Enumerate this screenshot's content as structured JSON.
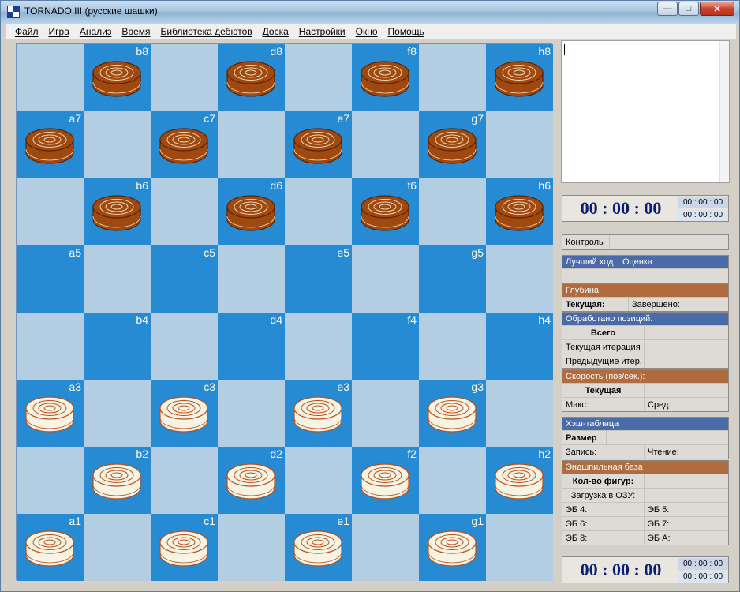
{
  "window": {
    "title": "TORNADO III (русские шашки)",
    "buttons": {
      "minimize": "—",
      "maximize": "□",
      "close": "✕"
    }
  },
  "menu": [
    "Файл",
    "Игра",
    "Анализ",
    "Время",
    "Библиотека дебютов",
    "Доска",
    "Настройки",
    "Окно",
    "Помощь"
  ],
  "colors": {
    "light_square": "#b3cde3",
    "dark_square": "#268bd2",
    "black_piece": "#a0490f",
    "white_piece": "#f8f4e4",
    "header_brown": "#b06c3e",
    "header_blue": "#4a6aa8",
    "clock_text": "#0b1e74"
  },
  "board": {
    "rows": [
      {
        "rank": "8",
        "squares": [
          {
            "label": "",
            "piece": ""
          },
          {
            "label": "b8",
            "piece": "black"
          },
          {
            "label": "",
            "piece": ""
          },
          {
            "label": "d8",
            "piece": "black"
          },
          {
            "label": "",
            "piece": ""
          },
          {
            "label": "f8",
            "piece": "black"
          },
          {
            "label": "",
            "piece": ""
          },
          {
            "label": "h8",
            "piece": "black"
          }
        ]
      },
      {
        "rank": "7",
        "squares": [
          {
            "label": "a7",
            "piece": "black"
          },
          {
            "label": "",
            "piece": ""
          },
          {
            "label": "c7",
            "piece": "black"
          },
          {
            "label": "",
            "piece": ""
          },
          {
            "label": "e7",
            "piece": "black"
          },
          {
            "label": "",
            "piece": ""
          },
          {
            "label": "g7",
            "piece": "black"
          },
          {
            "label": "",
            "piece": ""
          }
        ]
      },
      {
        "rank": "6",
        "squares": [
          {
            "label": "",
            "piece": ""
          },
          {
            "label": "b6",
            "piece": "black"
          },
          {
            "label": "",
            "piece": ""
          },
          {
            "label": "d6",
            "piece": "black"
          },
          {
            "label": "",
            "piece": ""
          },
          {
            "label": "f6",
            "piece": "black"
          },
          {
            "label": "",
            "piece": ""
          },
          {
            "label": "h6",
            "piece": "black"
          }
        ]
      },
      {
        "rank": "5",
        "squares": [
          {
            "label": "a5",
            "piece": ""
          },
          {
            "label": "",
            "piece": ""
          },
          {
            "label": "c5",
            "piece": ""
          },
          {
            "label": "",
            "piece": ""
          },
          {
            "label": "e5",
            "piece": ""
          },
          {
            "label": "",
            "piece": ""
          },
          {
            "label": "g5",
            "piece": ""
          },
          {
            "label": "",
            "piece": ""
          }
        ]
      },
      {
        "rank": "4",
        "squares": [
          {
            "label": "",
            "piece": ""
          },
          {
            "label": "b4",
            "piece": ""
          },
          {
            "label": "",
            "piece": ""
          },
          {
            "label": "d4",
            "piece": ""
          },
          {
            "label": "",
            "piece": ""
          },
          {
            "label": "f4",
            "piece": ""
          },
          {
            "label": "",
            "piece": ""
          },
          {
            "label": "h4",
            "piece": ""
          }
        ]
      },
      {
        "rank": "3",
        "squares": [
          {
            "label": "a3",
            "piece": "white"
          },
          {
            "label": "",
            "piece": ""
          },
          {
            "label": "c3",
            "piece": "white"
          },
          {
            "label": "",
            "piece": ""
          },
          {
            "label": "e3",
            "piece": "white"
          },
          {
            "label": "",
            "piece": ""
          },
          {
            "label": "g3",
            "piece": "white"
          },
          {
            "label": "",
            "piece": ""
          }
        ]
      },
      {
        "rank": "2",
        "squares": [
          {
            "label": "",
            "piece": ""
          },
          {
            "label": "b2",
            "piece": "white"
          },
          {
            "label": "",
            "piece": ""
          },
          {
            "label": "d2",
            "piece": "white"
          },
          {
            "label": "",
            "piece": ""
          },
          {
            "label": "f2",
            "piece": "white"
          },
          {
            "label": "",
            "piece": ""
          },
          {
            "label": "h2",
            "piece": "white"
          }
        ]
      },
      {
        "rank": "1",
        "squares": [
          {
            "label": "a1",
            "piece": "white"
          },
          {
            "label": "",
            "piece": ""
          },
          {
            "label": "c1",
            "piece": "white"
          },
          {
            "label": "",
            "piece": ""
          },
          {
            "label": "e1",
            "piece": "white"
          },
          {
            "label": "",
            "piece": ""
          },
          {
            "label": "g1",
            "piece": "white"
          },
          {
            "label": "",
            "piece": ""
          }
        ]
      }
    ]
  },
  "clock_top": {
    "main": "00 : 00 : 00",
    "sub1": "00 : 00 : 00",
    "sub2": "00 : 00 : 00"
  },
  "clock_bottom": {
    "main": "00 : 00 : 00",
    "sub1": "00 : 00 : 00",
    "sub2": "00 : 00 : 00"
  },
  "control": {
    "label": "Контроль",
    "value": ""
  },
  "best_move": {
    "label": "Лучший ход",
    "eval_label": "Оценка",
    "move": "",
    "eval": ""
  },
  "depth": {
    "header": "Глубина",
    "current_label": "Текущая:",
    "completed_label": "Завершено:"
  },
  "positions": {
    "header": "Обработано позиций:",
    "total_label": "Всего",
    "current_iter_label": "Текущая итерация",
    "prev_iter_label": "Предыдущие итер."
  },
  "speed": {
    "header": "Скорость (поз/сек.):",
    "current_label": "Текущая",
    "max_label": "Макс:",
    "avg_label": "Сред:"
  },
  "hash": {
    "header": "Хэш-таблица",
    "size_label": "Размер",
    "write_label": "Запись:",
    "read_label": "Чтение:"
  },
  "endgame": {
    "header": "Эндшпильная база",
    "pieces_label": "Кол-во фигур:",
    "ram_label": "Загрузка в ОЗУ:",
    "eb4": "ЭБ 4:",
    "eb5": "ЭБ 5:",
    "eb6": "ЭБ 6:",
    "eb7": "ЭБ 7:",
    "eb8": "ЭБ 8:",
    "ebA": "ЭБ А:"
  }
}
